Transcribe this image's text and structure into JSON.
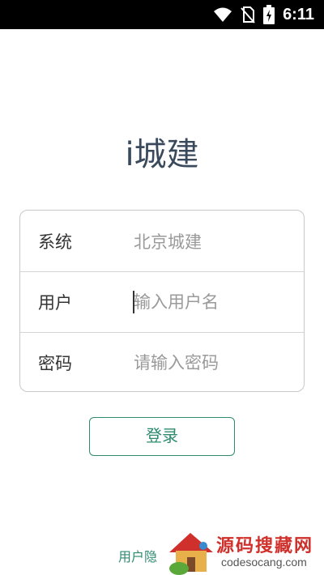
{
  "status_bar": {
    "time": "6:11",
    "icons": [
      "wifi-icon",
      "no-sim-icon",
      "battery-charging-icon"
    ]
  },
  "app": {
    "title": "i城建"
  },
  "form": {
    "rows": [
      {
        "label": "系统",
        "value": "北京城建"
      },
      {
        "label": "用户",
        "placeholder": "输入用户名"
      },
      {
        "label": "密码",
        "placeholder": "请输入密码"
      }
    ]
  },
  "login_button": {
    "label": "登录"
  },
  "privacy_link": {
    "label": "用户隐"
  },
  "watermark": {
    "brand_cn": "源码搜藏网",
    "brand_en": "codesocang.com"
  },
  "colors": {
    "accent": "#2e8b6e",
    "title": "#3a4a5c",
    "watermark_red": "#d0302b"
  }
}
